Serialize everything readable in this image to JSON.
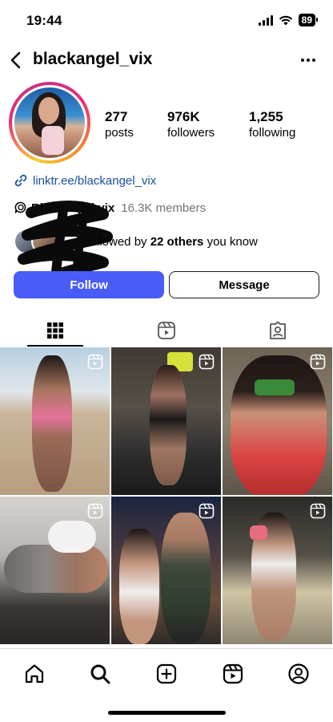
{
  "status_bar": {
    "time": "19:44",
    "battery": "89"
  },
  "header": {
    "username": "blackangel_vix",
    "back_icon": "chevron-left-icon",
    "more_icon": "more-horizontal-icon"
  },
  "profile": {
    "stats": [
      {
        "value": "277",
        "label": "posts"
      },
      {
        "value": "976K",
        "label": "followers"
      },
      {
        "value": "1,255",
        "label": "following"
      }
    ],
    "link": "linktr.ee/blackangel_vix",
    "channel": {
      "name": "Blackangel vix",
      "members": "16.3K members"
    },
    "followed_by": {
      "prefix": "llowed by ",
      "count": "22 others",
      "suffix": " you know"
    }
  },
  "buttons": {
    "follow": "Follow",
    "message": "Message"
  },
  "tabs": [
    "grid-icon",
    "reels-icon",
    "tagged-icon"
  ],
  "nav": [
    "home-icon",
    "search-icon",
    "create-icon",
    "reels-icon",
    "profile-icon"
  ],
  "colors": {
    "follow_button": "#4a5cf6",
    "link": "#1a4f9c"
  }
}
